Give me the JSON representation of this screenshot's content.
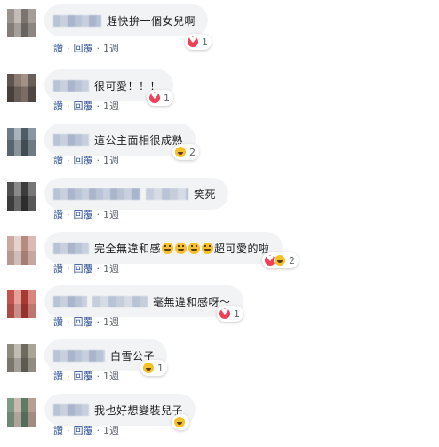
{
  "comments": [
    {
      "text": "趕快拚一個女兒啊",
      "reaction_count": "1",
      "actions": {
        "like": "讚",
        "reply": "回覆",
        "time": "1週"
      }
    },
    {
      "text": "很可愛！！！",
      "reaction_count": "1",
      "actions": {
        "like": "讚",
        "reply": "回覆",
        "time": "1週"
      }
    },
    {
      "text": "這公主面相很成熟",
      "reaction_count": "2",
      "actions": {
        "like": "讚",
        "reply": "回覆",
        "time": "1週"
      }
    },
    {
      "text": "笑死",
      "actions": {
        "like": "讚",
        "reply": "回覆",
        "time": "1週"
      }
    },
    {
      "text_before": "完全無違和感",
      "text_after": "超可愛的啦",
      "reaction_count": "2",
      "actions": {
        "like": "讚",
        "reply": "回覆",
        "time": "1週"
      }
    },
    {
      "text": "毫無違和感呀～",
      "reaction_count": "1",
      "actions": {
        "like": "讚",
        "reply": "回覆",
        "time": "1週"
      }
    },
    {
      "text": "白雪公子",
      "reaction_count": "1",
      "actions": {
        "like": "讚",
        "reply": "回覆",
        "time": "1週"
      }
    },
    {
      "text": "我也好想變裝兒子",
      "actions": {
        "like": "讚",
        "reply": "回覆",
        "time": "1週"
      }
    }
  ],
  "icons": {
    "love": "love-reaction-icon",
    "haha": "haha-reaction-icon",
    "emoji": "laughing-emoji"
  },
  "colors": {
    "bubble": "#f2f3f5",
    "link": "#385898",
    "meta": "#606770",
    "love": "#f33e58",
    "haha": "#f7c02a"
  }
}
